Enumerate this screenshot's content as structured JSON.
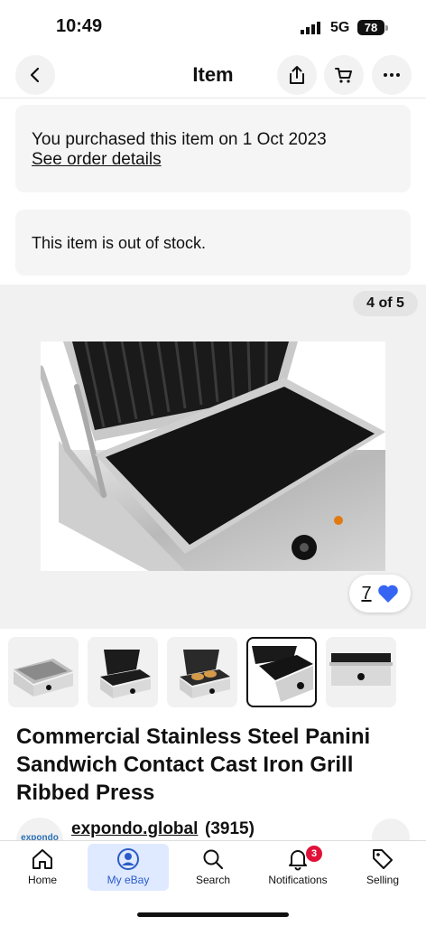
{
  "status_bar": {
    "time": "10:49",
    "network": "5G",
    "battery": "78"
  },
  "nav": {
    "title": "Item",
    "icons": [
      "chevron-left-icon",
      "share-icon",
      "cart-icon",
      "more-icon"
    ]
  },
  "purchase": {
    "text": "You purchased this item on 1 Oct 2023",
    "link": "See order details"
  },
  "stock": {
    "text": "This item is out of stock."
  },
  "gallery": {
    "counter": "4 of 5",
    "watch_count": "7",
    "thumbnail_count": 5,
    "selected_thumbnail": 4
  },
  "item": {
    "title": "Commercial Stainless Steel Panini Sandwich Contact Cast Iron Grill Ribbed Press"
  },
  "seller": {
    "logo_text": "expondo",
    "name": "expondo.global",
    "feedback": "(3915)"
  },
  "tabs": [
    {
      "label": "Home",
      "icon": "home-icon"
    },
    {
      "label": "My eBay",
      "icon": "user-icon",
      "active": true
    },
    {
      "label": "Search",
      "icon": "search-icon"
    },
    {
      "label": "Notifications",
      "icon": "bell-icon",
      "badge": "3"
    },
    {
      "label": "Selling",
      "icon": "tag-icon"
    }
  ],
  "colors": {
    "accent": "#2a5cc9",
    "heart": "#3665f3",
    "badge": "#e0123a",
    "card": "#f5f5f5"
  }
}
